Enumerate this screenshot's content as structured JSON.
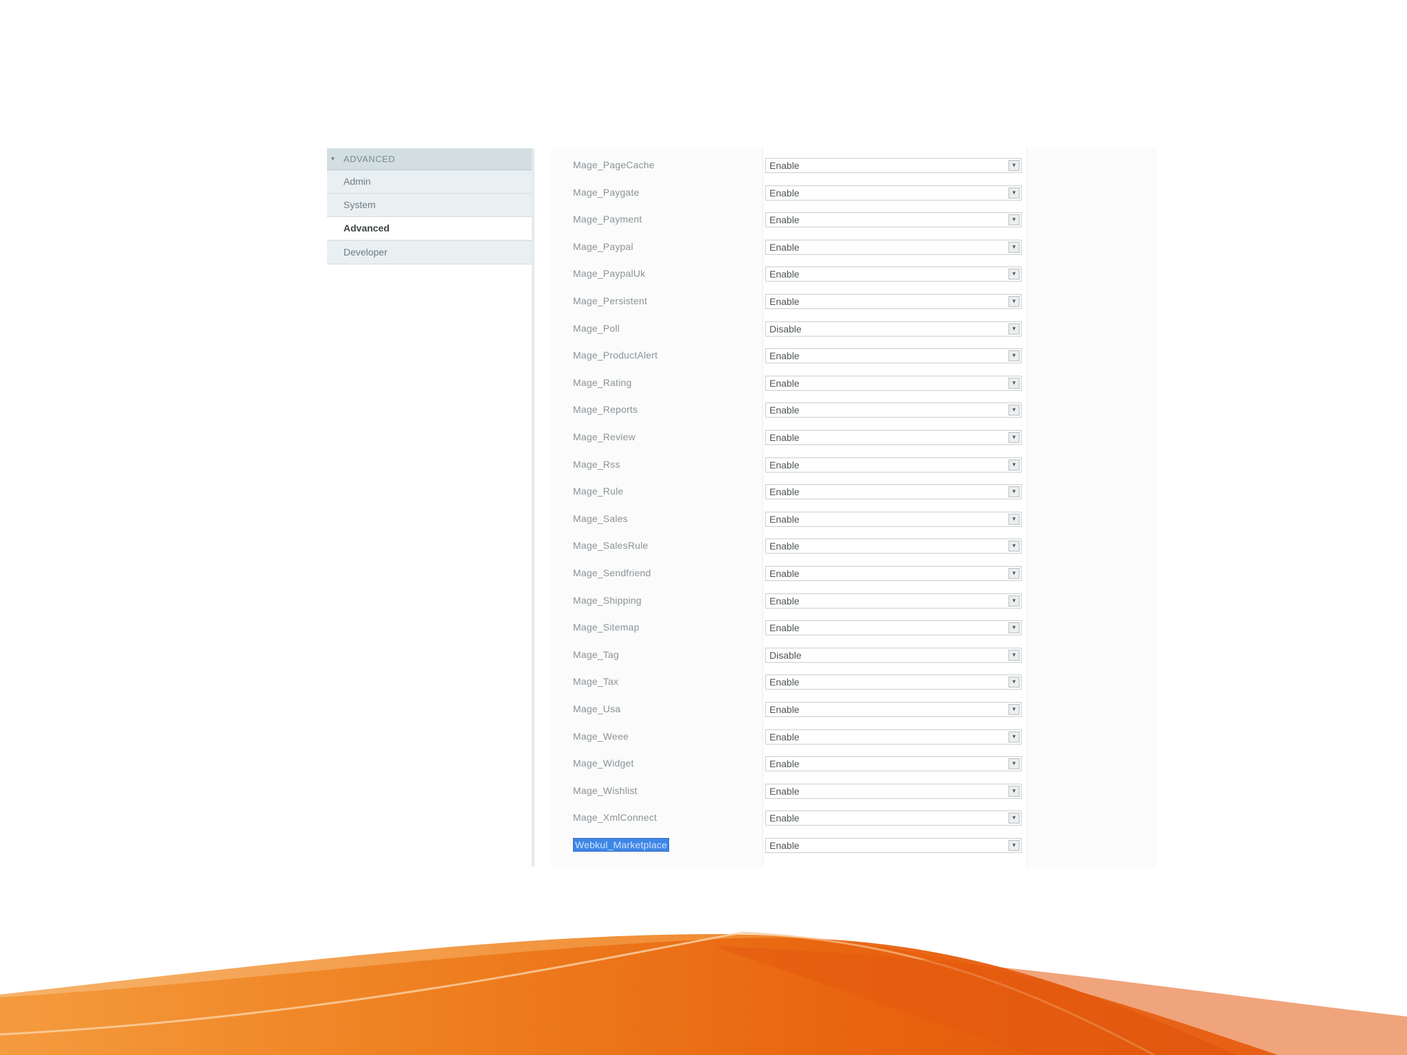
{
  "sidebar": {
    "group_label": "ADVANCED",
    "items": [
      {
        "label": "Admin",
        "active": false
      },
      {
        "label": "System",
        "active": false
      },
      {
        "label": "Advanced",
        "active": true
      },
      {
        "label": "Developer",
        "active": false
      }
    ]
  },
  "modules": [
    {
      "name": "Mage_PageCache",
      "value": "Enable"
    },
    {
      "name": "Mage_Paygate",
      "value": "Enable"
    },
    {
      "name": "Mage_Payment",
      "value": "Enable"
    },
    {
      "name": "Mage_Paypal",
      "value": "Enable"
    },
    {
      "name": "Mage_PaypalUk",
      "value": "Enable"
    },
    {
      "name": "Mage_Persistent",
      "value": "Enable"
    },
    {
      "name": "Mage_Poll",
      "value": "Disable"
    },
    {
      "name": "Mage_ProductAlert",
      "value": "Enable"
    },
    {
      "name": "Mage_Rating",
      "value": "Enable"
    },
    {
      "name": "Mage_Reports",
      "value": "Enable"
    },
    {
      "name": "Mage_Review",
      "value": "Enable"
    },
    {
      "name": "Mage_Rss",
      "value": "Enable"
    },
    {
      "name": "Mage_Rule",
      "value": "Enable"
    },
    {
      "name": "Mage_Sales",
      "value": "Enable"
    },
    {
      "name": "Mage_SalesRule",
      "value": "Enable"
    },
    {
      "name": "Mage_Sendfriend",
      "value": "Enable"
    },
    {
      "name": "Mage_Shipping",
      "value": "Enable"
    },
    {
      "name": "Mage_Sitemap",
      "value": "Enable"
    },
    {
      "name": "Mage_Tag",
      "value": "Disable"
    },
    {
      "name": "Mage_Tax",
      "value": "Enable"
    },
    {
      "name": "Mage_Usa",
      "value": "Enable"
    },
    {
      "name": "Mage_Weee",
      "value": "Enable"
    },
    {
      "name": "Mage_Widget",
      "value": "Enable"
    },
    {
      "name": "Mage_Wishlist",
      "value": "Enable"
    },
    {
      "name": "Mage_XmlConnect",
      "value": "Enable"
    },
    {
      "name": "Webkul_Marketplace",
      "value": "Enable",
      "selected": true
    }
  ],
  "colors": {
    "wave_orange": "#e8620e",
    "wave_light": "#f4a060",
    "selection_blue": "#3e86e6"
  }
}
